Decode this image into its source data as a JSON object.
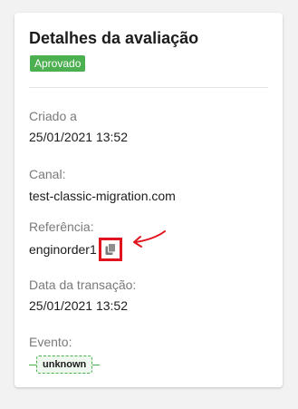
{
  "card": {
    "title": "Detalhes da avaliação",
    "status_badge": "Aprovado",
    "fields": {
      "created_label": "Criado a",
      "created_value": "25/01/2021 13:52",
      "channel_label": "Canal:",
      "channel_value": "test-classic-migration.com",
      "reference_label": "Referência:",
      "reference_value": "enginorder1",
      "transaction_date_label": "Data da transação:",
      "transaction_date_value": "25/01/2021 13:52",
      "event_label": "Evento:",
      "event_value": "unknown"
    },
    "icons": {
      "copy": "copy-icon",
      "annotation": "red-arrow-annotation"
    },
    "colors": {
      "approved_badge": "#4caf50",
      "highlight": "#e0141e"
    }
  }
}
